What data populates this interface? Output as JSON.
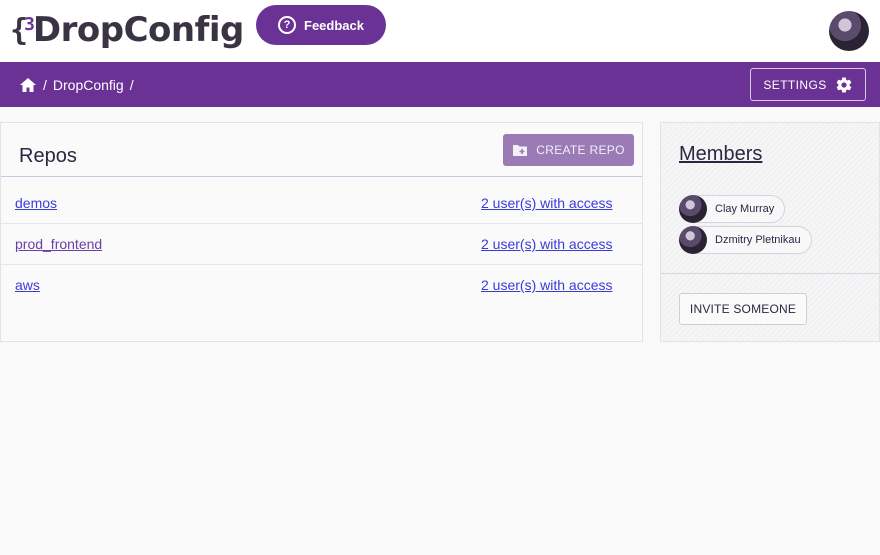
{
  "brand": {
    "logo_mark_left": "{",
    "logo_mark_accent": "3",
    "name": "DropConfig",
    "primary_color": "#6b3296"
  },
  "header": {
    "feedback_label": "Feedback",
    "feedback_icon": "question-circle-icon",
    "avatar_icon": "user-avatar"
  },
  "nav": {
    "home_icon": "home-icon",
    "breadcrumb": [
      "/",
      "DropConfig",
      "/"
    ],
    "settings_label": "SETTINGS",
    "settings_icon": "gear-icon"
  },
  "repos": {
    "title": "Repos",
    "create_label": "CREATE REPO",
    "create_icon": "folder-plus-icon",
    "rows": [
      {
        "name": "demos",
        "access": "2 user(s) with access"
      },
      {
        "name": "prod_frontend",
        "access": "2 user(s) with access"
      },
      {
        "name": "aws",
        "access": "2 user(s) with access"
      }
    ]
  },
  "members": {
    "title": "Members",
    "people": [
      {
        "name": "Clay Murray"
      },
      {
        "name": "Dzmitry Pletnikau"
      }
    ],
    "invite_label": "INVITE SOMEONE"
  }
}
